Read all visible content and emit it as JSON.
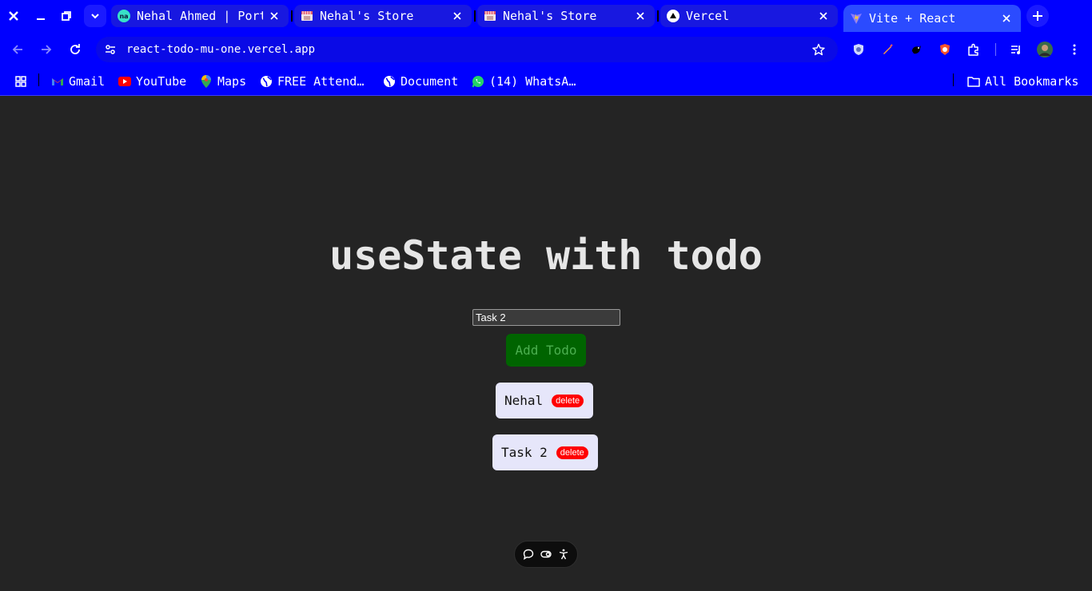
{
  "browser": {
    "window_controls": {
      "close_icon": "close-icon",
      "minimize_icon": "minimize-icon",
      "restore_icon": "restore-icon"
    },
    "tabs": [
      {
        "title": "Nehal Ahmed | Portfolio",
        "favicon": "na-logo-icon",
        "active": false
      },
      {
        "title": "Nehal's Store",
        "favicon": "store-icon",
        "active": false
      },
      {
        "title": "Nehal's Store",
        "favicon": "store-icon",
        "active": false
      },
      {
        "title": "Vercel",
        "favicon": "vercel-icon",
        "active": false
      },
      {
        "title": "Vite + React",
        "favicon": "vite-icon",
        "active": true
      }
    ],
    "url": "react-todo-mu-one.vercel.app",
    "bookmarks": [
      {
        "label": "Gmail",
        "icon": "gmail-icon"
      },
      {
        "label": "YouTube",
        "icon": "youtube-icon"
      },
      {
        "label": "Maps",
        "icon": "maps-icon"
      },
      {
        "label": "FREE Attend…",
        "icon": "globe-icon"
      },
      {
        "label": "Document",
        "icon": "globe-icon"
      },
      {
        "label": "(14) WhatsA…",
        "icon": "whatsapp-icon"
      }
    ],
    "all_bookmarks_label": "All Bookmarks",
    "colors": {
      "chrome": "#0000ff",
      "active_tab": "#2b4bff"
    }
  },
  "app": {
    "title": "useState with todo",
    "input": {
      "value": "Task 2",
      "placeholder": ""
    },
    "add_button_label": "Add Todo",
    "todos": [
      {
        "text": "Nehal",
        "delete_label": "delete"
      },
      {
        "text": "Task 2",
        "delete_label": "delete"
      }
    ],
    "colors": {
      "background": "#242424",
      "add_button": "#006400",
      "add_button_text": "#4caf50",
      "todo_bg": "#e6e6fa",
      "delete_bg": "#ff0000"
    }
  }
}
